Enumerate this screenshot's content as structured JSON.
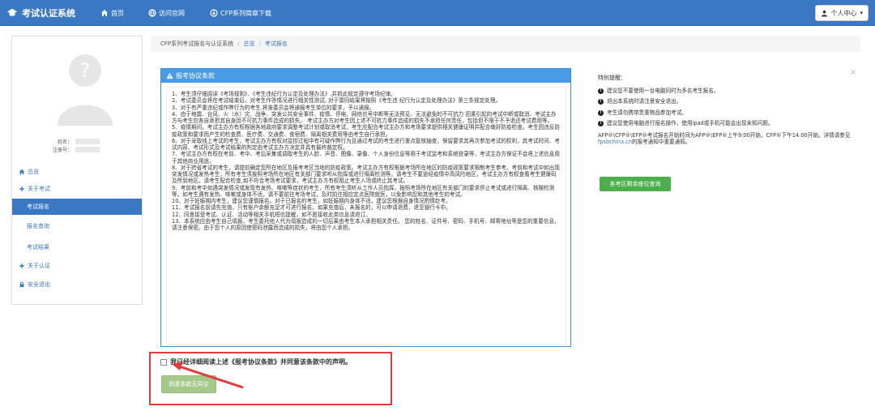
{
  "app": {
    "title": "考试认证系统"
  },
  "nav": {
    "home": "首页",
    "official_site": "访问官网",
    "download": "CFP系列简章下载"
  },
  "user_menu": {
    "label": "个人中心"
  },
  "profile": {
    "name_label": "姓名：",
    "id_label": "注册号："
  },
  "sidebar": {
    "items": [
      {
        "label": "总览"
      },
      {
        "label": "关于考试"
      },
      {
        "label": "考试报名"
      },
      {
        "label": "报名查询"
      },
      {
        "label": "考试结果"
      },
      {
        "label": "关于认证"
      },
      {
        "label": "安全退出"
      }
    ]
  },
  "breadcrumb": {
    "root": "CFP系列考试报名与认证系统",
    "level1": "总览",
    "level2": "考试报名"
  },
  "terms": {
    "title": "报考协议条款",
    "paragraphs": [
      "1、考生须仔细阅读《考场规则》、《考生违纪行为认定及处理办法》,并抓此规定遵守考场纪律。",
      "2、考试委员会将在考试结束后，对考生作答情况进行相关性测试, 对于雷同结果将按照《考生违 纪行为认定及处理办法》第三条规定处理。",
      "3、对于有严重违纪或作弊行为的考生,将准委员会将通报考生单位的要求，予以通报。",
      "4、由于地震、台风、火（水）灾、战争、突发公共安全事件、疫情、停电、网络信号中断等无法预见、无法避免的不可抗力 因素引起的考试中断或取消、考试主办方与考生应各自承担其自身因不可抗力事件造成的损失。 考试主办方对考生因上述不可抗力事件造成的损失不承担任何责任，包括但不限于不予退还考试费用等。",
      "5、疫情期间，考试主办方有权根据各地政府要求调整考试计划或取消考试，考生应配合考试主办方和考场要求提供相关健康证明并配合做好防疫检查。考生因违反防疫政策和要求而产生的检查费、医疗费、交通费、食宿费、隔离相关费用等由考生自行承担。",
      "6、对于采取线上考试的考生，考试主办方有权对监控过程中有可疑作弊行为且通过考试的考生进行重点复核抽查，保留要求其再次参加考试的权利，其考试时间、考试内容、考试形式及考试结果的判定由考试主办方决定并具有最终裁定权。",
      "7、考试主办方有权在考前、考中、考后采集或调取考生的人脸、声音、图像、录像、个人身份信息等用于考试监考和系统登录等，考试主办方保证不会将上述信息用于其他商业用途。",
      "8、对于跨省考试的考生，请提前确定您所在地区及报考考区当地的防疫政策。考试主办方有权根据考场所在地区的防疫政策要求限制考生参考。考前和考试中如出现突发情况或发热考生，所有考生须按照考场所在地区有关部门要求听从指挥或进行隔离检测等。请考生不要途经疫情中高风险地区，考试主办方有权查看考生健康码及所到地区。请考生配合检查,如不符合考场考试要求，考试主办方有权阻止考生入场或终止其考试。",
      "9、考前和考中如遇突发情况或发现有发热、咳嗽等症状的考生，所有考生须听从工作人员指挥，按照考场所在地区有关部门的要求停止考试或进行隔离、核酸检测等。如考生遇有发热、咳嗽或身体不适，请不要前往考场考试，及时前往相应定点医院就医，以免影响您和其他考生的考试。",
      "10、对于妊娠期内考生，建议您谨慎报名。对于已报名的考生，如妊娠期内身体不适，建议您根据自身情况酌情赴考。",
      "11、考试报名前请先充值，只有账户余额充足才可进行报名。如果充值后，未报名的，可以申请退费，退至银行卡中。",
      "12、同意接受考试、认证、活动等相关手机短信提醒，如不愿接收此类信息请退订。",
      "13、本系统应由考生自己填报，考生委托他人代为填报造成的一切后果由考生本人承担相关责任。 您的姓名、证件号、密码、手机号、邮寄地址等是您的重要信息，请注意保密。由于您个人的原因使密码泄露而造成的损失，将由您个人承担。"
    ]
  },
  "agree": {
    "checkbox_label": "我已经详细阅读上述《报考协议条款》并同意该条款中的声明。",
    "button_label": "同意条款无异议"
  },
  "notice": {
    "title": "特别提醒：",
    "items": [
      "建议您不要使用一台电脑同时为多名考生报名。",
      "退出本系统时请注意安全退出。",
      "考生请勿携带贵重物品参加考试。",
      "建议您使用电脑进行报名操作，使用ipad或手机可能会出现未知问题。"
    ],
    "schedule_text": "AFP®\\CFP®\\EFP®考试报名开始时间为AFP®\\EFP®上午9:00开始，CFP®下午14:00开始。详情请参见",
    "site": "fpsbchina.cn",
    "schedule_tail": "的报考通知中重要通知。",
    "query_button": "各考区剩余座位查询",
    "close": "×"
  }
}
